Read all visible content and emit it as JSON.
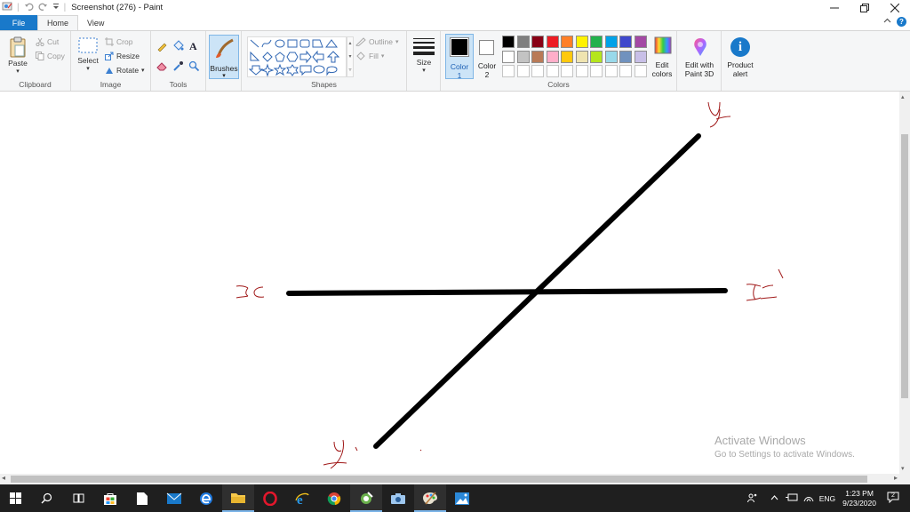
{
  "window": {
    "title": "Screenshot (276) - Paint"
  },
  "tabs": [
    "File",
    "Home",
    "View"
  ],
  "ribbon": {
    "clipboard": {
      "label": "Clipboard",
      "paste": "Paste",
      "cut": "Cut",
      "copy": "Copy"
    },
    "image": {
      "label": "Image",
      "select": "Select",
      "crop": "Crop",
      "resize": "Resize",
      "rotate": "Rotate"
    },
    "tools": {
      "label": "Tools"
    },
    "brushes": {
      "label": "Brushes"
    },
    "shapes": {
      "label": "Shapes",
      "outline": "Outline",
      "fill": "Fill"
    },
    "size": {
      "label": "Size"
    },
    "colors": {
      "label": "Colors",
      "color1": "Color 1",
      "color1_line1": "Color",
      "color1_line2": "1",
      "color2_line1": "Color",
      "color2_line2": "2",
      "edit_colors_line1": "Edit",
      "edit_colors_line2": "colors",
      "row1": [
        "#000000",
        "#7f7f7f",
        "#880015",
        "#ed1c24",
        "#ff7f27",
        "#fff200",
        "#22b14c",
        "#00a2e8",
        "#3f48cc",
        "#a349a4"
      ],
      "row2": [
        "#ffffff",
        "#c3c3c3",
        "#b97a57",
        "#ffaec9",
        "#ffc90e",
        "#efe4b0",
        "#b5e61d",
        "#99d9ea",
        "#7092be",
        "#c8bfe7"
      ]
    },
    "paint3d": {
      "line1": "Edit with",
      "line2": "Paint 3D"
    },
    "product_alert": {
      "line1": "Product",
      "line2": "alert"
    }
  },
  "watermark": {
    "title": "Activate Windows",
    "subtitle": "Go to Settings to activate Windows."
  },
  "taskbar": {
    "language": "ENG",
    "time": "1:23 PM",
    "date": "9/23/2020",
    "notifications": "2"
  }
}
